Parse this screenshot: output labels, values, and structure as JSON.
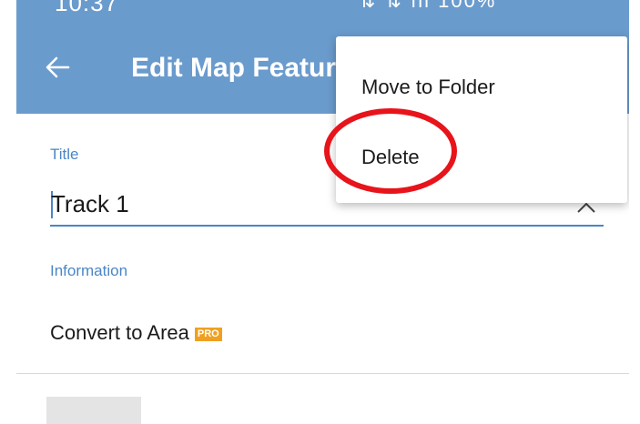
{
  "status_bar": {
    "time": "10:37",
    "battery": "100%"
  },
  "app_bar": {
    "title": "Edit Map Feature",
    "back_icon": "arrow-left-icon"
  },
  "form": {
    "title_label": "Title",
    "title_value": "Track 1",
    "info_label": "Information",
    "convert_label": "Convert to Area",
    "pro_badge": "PRO"
  },
  "menu": {
    "items": [
      {
        "label": "Move to Folder"
      },
      {
        "label": "Delete"
      }
    ]
  },
  "colors": {
    "app_bar": "#6a9bcd",
    "accent": "#4a86c5",
    "annotation": "#e8141b",
    "pro_badge": "#f0a020"
  }
}
